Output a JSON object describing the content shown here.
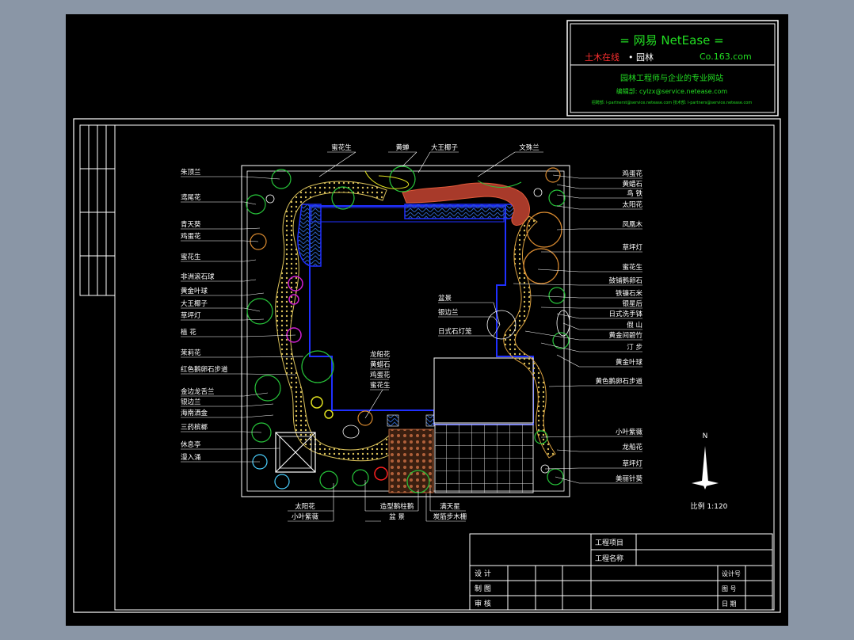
{
  "header": {
    "logo_line": "= 网易 NetEase =",
    "channel_red": "土木在线",
    "channel_sep": "•",
    "channel_white": "园林",
    "domain": "Co.163.com",
    "slogan": "园林工程师与企业的专业网站",
    "email": "编辑部: cylzx@service.netease.com",
    "contact": "招聘部: l-partnerst@service.netease.com  技术部: l-partners@service.netease.com"
  },
  "labels": {
    "left": [
      "朱顶兰",
      "鸢尾花",
      "青天葵",
      "鸡蛋花",
      "蜜花生",
      "非洲滚石球",
      "黄金叶球",
      "大王椰子",
      "草坪灯",
      "植 花",
      "茉莉花",
      "红色鹅卵石步道",
      "金边龙舌兰",
      "银边兰",
      "海南洒金",
      "三药槟榔",
      "休息亭",
      "漫入涌"
    ],
    "right": [
      "鸡蛋花",
      "黄蜡石",
      "鸟 铁",
      "太阳花",
      "凤凰木",
      "草坪灯",
      "蜜花生",
      "鼓铺鹅卵石",
      "铁镰石米",
      "银星后",
      "日式洗手钵",
      "假 山",
      "黄金间碧竹",
      "汀 步",
      "黄金叶球",
      "黄色鹅卵石步道",
      "小叶紫薇",
      "龙船花",
      "草坪灯",
      "美丽针葵"
    ],
    "top": [
      "蜜花生",
      "黄蝉",
      "大王椰子",
      "文殊兰"
    ],
    "inner_mid": [
      "盆景",
      "银边兰",
      "日式石灯笼"
    ],
    "inner_low": [
      "龙船花",
      "黄蜡石",
      "鸡蛋花",
      "蜜花生"
    ],
    "bottom_left": [
      "太阳花",
      "小叶紫薇"
    ],
    "bottom_mid": [
      "造型鹅柱鹅",
      "盆 景"
    ],
    "bottom_right": [
      "满天星",
      "炭筋步木栅"
    ]
  },
  "north": {
    "letter": "N",
    "scale": "比例  1:120"
  },
  "title_block": {
    "project_item": "工程项目",
    "project_name": "工程名称",
    "design": "设 计",
    "drawing": "制 图",
    "review": "审 核",
    "drawing_no": "设计号",
    "sheet_no": "图 号",
    "date": "日 期"
  },
  "colors": {
    "path_yellow": "#d9c05a",
    "path_red": "#c0392b",
    "water_blue": "#1f6fd8",
    "boundary_blue": "#2030ff",
    "plant_green": "#27c43a",
    "magenta": "#d020d0",
    "header_green": "#22dd22"
  }
}
